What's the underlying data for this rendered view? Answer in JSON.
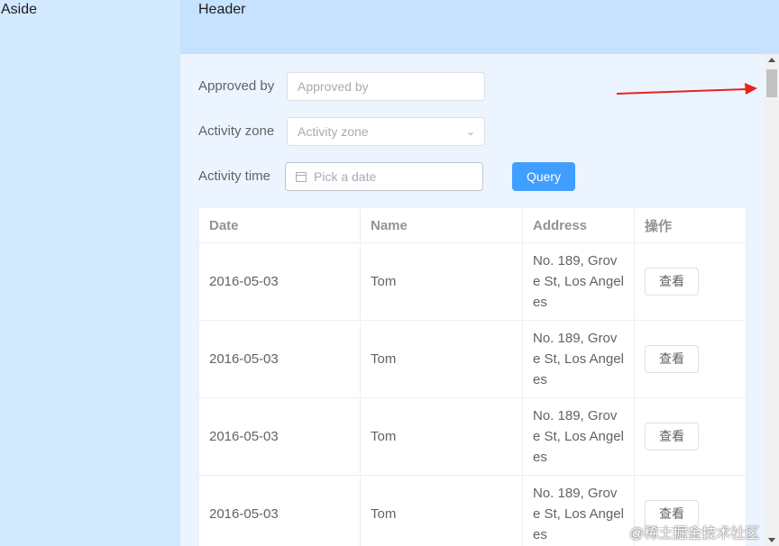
{
  "aside": {
    "label": "Aside"
  },
  "header": {
    "label": "Header"
  },
  "form": {
    "approved_by": {
      "label": "Approved by",
      "placeholder": "Approved by"
    },
    "activity_zone": {
      "label": "Activity zone",
      "placeholder": "Activity zone"
    },
    "activity_time": {
      "label": "Activity time",
      "placeholder": "Pick a date"
    },
    "query_label": "Query"
  },
  "table": {
    "columns": [
      "Date",
      "Name",
      "Address",
      "操作"
    ],
    "rows": [
      {
        "date": "2016-05-03",
        "name": "Tom",
        "address": "No. 189, Grove St, Los Angeles",
        "action": "查看"
      },
      {
        "date": "2016-05-03",
        "name": "Tom",
        "address": "No. 189, Grove St, Los Angeles",
        "action": "查看"
      },
      {
        "date": "2016-05-03",
        "name": "Tom",
        "address": "No. 189, Grove St, Los Angeles",
        "action": "查看"
      },
      {
        "date": "2016-05-03",
        "name": "Tom",
        "address": "No. 189, Grove St, Los Angeles",
        "action": "查看"
      }
    ]
  },
  "watermark": "@稀土掘金技术社区",
  "colors": {
    "aside": "#d3e9fe",
    "header": "#c6e2ff",
    "main": "#ecf5ff",
    "primary": "#409eff",
    "annotation_arrow": "#e8231c"
  }
}
